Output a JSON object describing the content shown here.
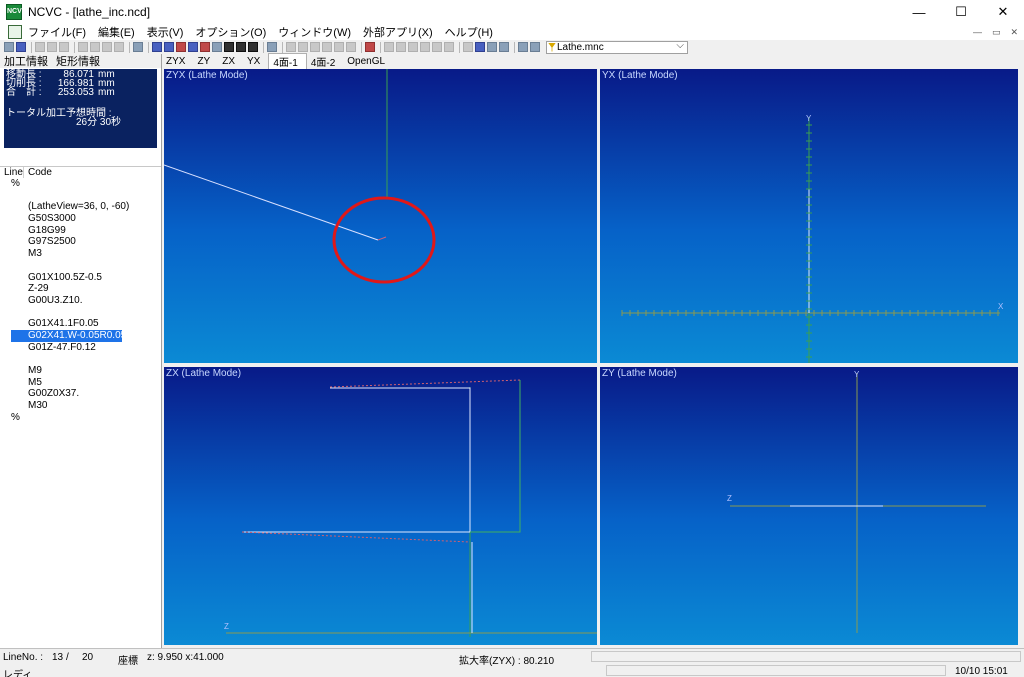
{
  "window": {
    "title": "NCVC - [lathe_inc.ncd]",
    "app_icon_text": "NCVC"
  },
  "menu": [
    "ファイル(F)",
    "編集(E)",
    "表示(V)",
    "オプション(O)",
    "ウィンドウ(W)",
    "外部アプリ(X)",
    "ヘルプ(H)"
  ],
  "toolbar": {
    "combo_value": "Lathe.mnc"
  },
  "left": {
    "tabs": [
      "加工情報",
      "矩形情報"
    ],
    "info": {
      "rows": [
        {
          "label": "移動長 :",
          "value": "86.071",
          "unit": "mm"
        },
        {
          "label": "切削長 :",
          "value": "166.981",
          "unit": "mm"
        },
        {
          "label": "合　計 :",
          "value": "253.053",
          "unit": "mm"
        }
      ],
      "time_label": "トータル加工予想時間 :",
      "time_value": "26分 30秒"
    },
    "code_headers": [
      "Line",
      "Code"
    ],
    "code": [
      "%",
      "",
      "(LatheView=36, 0, -60)",
      "G50S3000",
      "G18G99",
      "G97S2500",
      "M3",
      "",
      "G01X100.5Z-0.5",
      "Z-29",
      "G00U3.Z10.",
      "",
      "G01X41.1F0.05",
      "G02X41.W-0.05R0.05",
      "G01Z-47.F0.12",
      "",
      "M9",
      "M5",
      "G00Z0X37.",
      "M30",
      "%"
    ],
    "selected_line_index": 13
  },
  "view_tabs": [
    "ZYX",
    "ZY",
    "ZX",
    "YX",
    "4面-1",
    "4面-2",
    "OpenGL"
  ],
  "active_view_tab_index": 4,
  "viewports": {
    "zyx": {
      "label": "ZYX (Lathe Mode)"
    },
    "yx": {
      "label": "YX (Lathe Mode)",
      "axis_y": "Y",
      "axis_x": "X"
    },
    "zx": {
      "label": "ZX (Lathe Mode)",
      "axis_z": "Z"
    },
    "zy": {
      "label": "ZY (Lathe Mode)",
      "axis_y": "Y",
      "axis_z": "Z"
    }
  },
  "status": {
    "line_label": "LineNo. :",
    "line_current": "13",
    "line_sep": "/",
    "line_total": "20",
    "coord_label": "座標",
    "coord_value": "z: 9.950 x:41.000",
    "zoom_label": "拡大率(ZYX) : 80.210",
    "ready": "レディ",
    "datetime": "10/10  15:01"
  },
  "colors": {
    "viewport_top": "#081a88",
    "viewport_bottom": "#0b8ad4",
    "highlight_circle": "#e01818",
    "selection": "#1e73e8"
  }
}
